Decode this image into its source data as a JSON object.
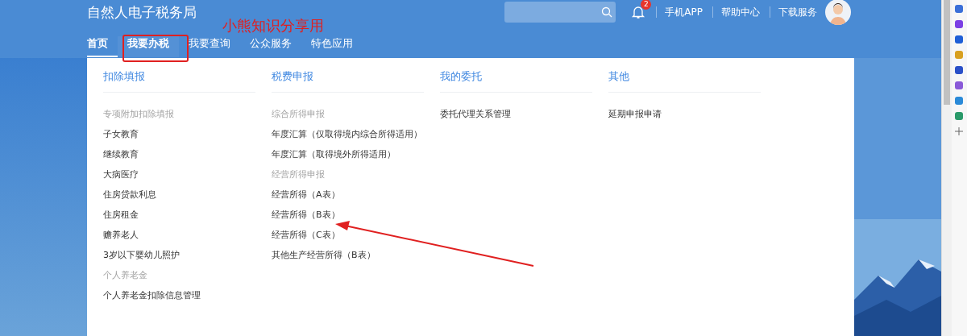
{
  "header": {
    "title": "自然人电子税务局",
    "notifications": {
      "badge": "2"
    },
    "links": [
      "手机APP",
      "帮助中心",
      "下载服务"
    ]
  },
  "nav": [
    {
      "label": "首页",
      "selected": true,
      "expanded": false
    },
    {
      "label": "我要办税",
      "selected": false,
      "expanded": true
    },
    {
      "label": "我要查询",
      "selected": false,
      "expanded": false
    },
    {
      "label": "公众服务",
      "selected": false,
      "expanded": false
    },
    {
      "label": "特色应用",
      "selected": false,
      "expanded": false
    }
  ],
  "menu": {
    "columns": [
      {
        "heading": "扣除填报",
        "groups": [
          {
            "label": "专项附加扣除填报",
            "items": [
              "子女教育",
              "继续教育",
              "大病医疗",
              "住房贷款利息",
              "住房租金",
              "赡养老人",
              "3岁以下婴幼儿照护"
            ]
          },
          {
            "label": "个人养老金",
            "items": [
              "个人养老金扣除信息管理"
            ]
          }
        ]
      },
      {
        "heading": "税费申报",
        "groups": [
          {
            "label": "综合所得申报",
            "items": [
              "年度汇算（仅取得境内综合所得适用）",
              "年度汇算（取得境外所得适用）"
            ]
          },
          {
            "label": "经营所得申报",
            "items": [
              "经营所得（A表）",
              "经营所得（B表）",
              "经营所得（C表）",
              "其他生产经营所得（B表）"
            ]
          }
        ]
      },
      {
        "heading": "我的委托",
        "groups": [
          {
            "items": [
              "委托代理关系管理"
            ]
          }
        ]
      },
      {
        "heading": "其他",
        "groups": [
          {
            "items": [
              "延期申报申请"
            ]
          }
        ]
      }
    ]
  },
  "annotation": {
    "label": "小熊知识分享用"
  }
}
